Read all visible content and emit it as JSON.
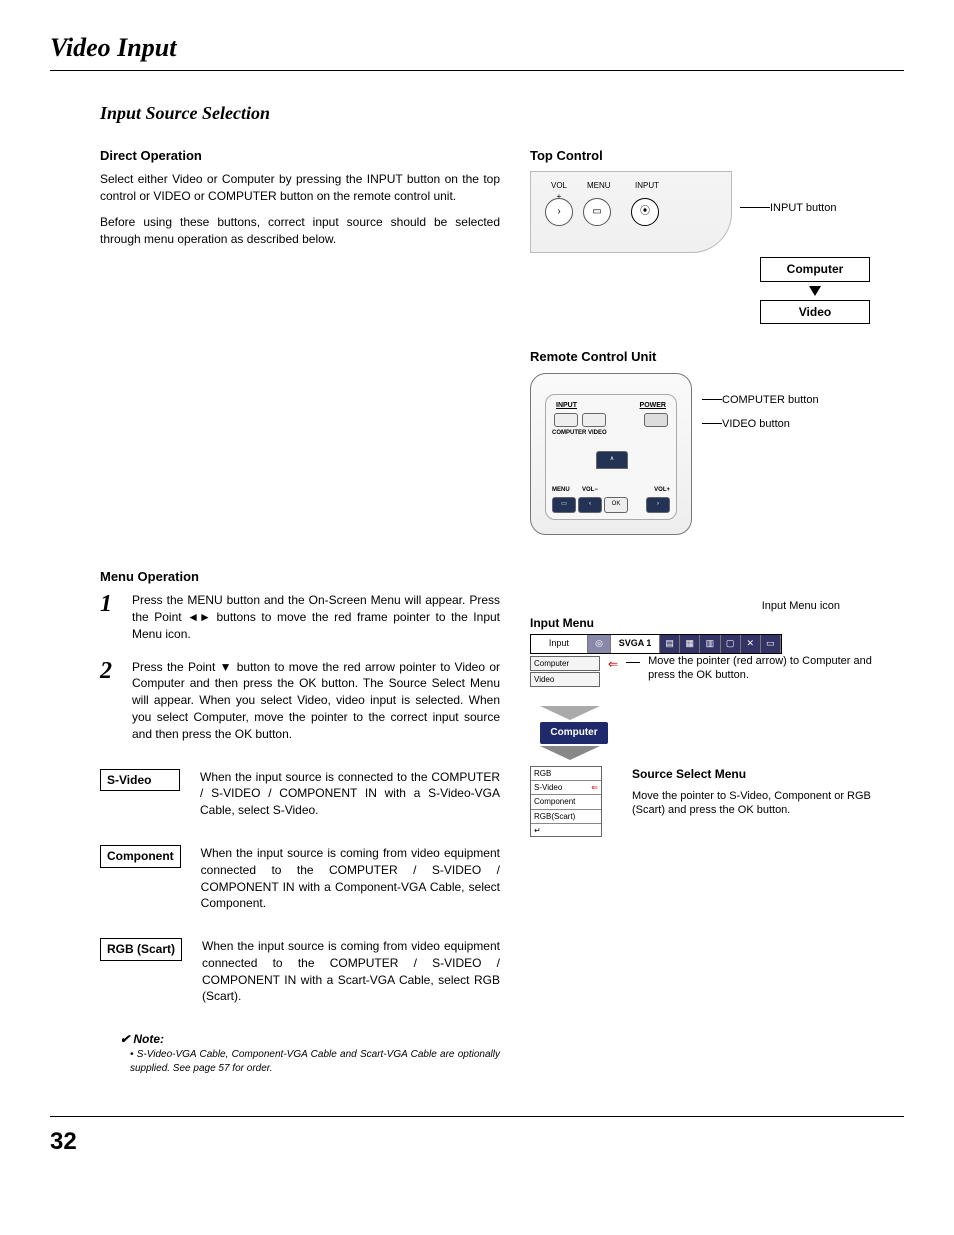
{
  "page_title": "Video Input",
  "section_title": "Input Source Selection",
  "direct_operation": {
    "heading": "Direct Operation",
    "para1": "Select either Video or Computer by pressing the INPUT button on the top control or VIDEO or COMPUTER button on the remote control unit.",
    "para2": "Before using these buttons, correct input source should be selected through menu operation as described below."
  },
  "menu_operation": {
    "heading": "Menu Operation",
    "step1": "Press the MENU button and the On-Screen Menu will appear.  Press the Point ◄► buttons to move the red frame pointer to the Input Menu icon.",
    "step2": "Press the Point ▼ button to move the red arrow pointer to Video or Computer and then press the OK button.  The Source Select Menu will appear.  When you select Video, video input is selected.  When you select Computer, move the pointer to the correct input source and then press the OK button."
  },
  "options": {
    "svideo": {
      "label": "S-Video",
      "desc": "When the input source is connected to the COMPUTER / S-VIDEO / COMPONENT IN with a S-Video-VGA Cable, select S-Video."
    },
    "component": {
      "label": "Component",
      "desc": "When the input source is coming from video equipment connected to the COMPUTER / S-VIDEO / COMPONENT IN with a Component-VGA Cable, select Component."
    },
    "rgbscart": {
      "label": "RGB (Scart)",
      "desc": "When the input source is coming from video equipment connected to the COMPUTER / S-VIDEO / COMPONENT IN with a Scart-VGA Cable, select RGB (Scart)."
    }
  },
  "note": {
    "title": "✔ Note:",
    "bullet": "• S-Video-VGA Cable, Component-VGA Cable and Scart-VGA Cable are optionally supplied.  See page 57 for order."
  },
  "top_control": {
    "heading": "Top Control",
    "vol": "VOL\n+",
    "menu": "MENU",
    "input": "INPUT",
    "input_button_label": "INPUT button",
    "flow_computer": "Computer",
    "flow_video": "Video"
  },
  "remote": {
    "heading": "Remote Control Unit",
    "input": "INPUT",
    "power": "POWER",
    "computer": "COMPUTER",
    "video": "VIDEO",
    "menu": "MENU",
    "volminus": "VOL−",
    "volplus": "VOL+",
    "ok": "OK",
    "computer_button": "COMPUTER button",
    "video_button": "VIDEO button"
  },
  "input_menu": {
    "icon_label": "Input Menu icon",
    "heading": "Input Menu",
    "menu_title": "Input",
    "svga": "SVGA 1",
    "item_computer": "Computer",
    "item_video": "Video",
    "caption1": "Move the pointer (red arrow) to Computer  and press the OK button.",
    "computer_tab": "Computer",
    "source_select_heading": "Source Select Menu",
    "caption2": "Move the pointer to S-Video, Component or RGB (Scart) and press the OK button.",
    "src_rgb": "RGB",
    "src_svideo": "S-Video",
    "src_component": "Component",
    "src_rgbscart": "RGB(Scart)"
  },
  "page_number": "32"
}
